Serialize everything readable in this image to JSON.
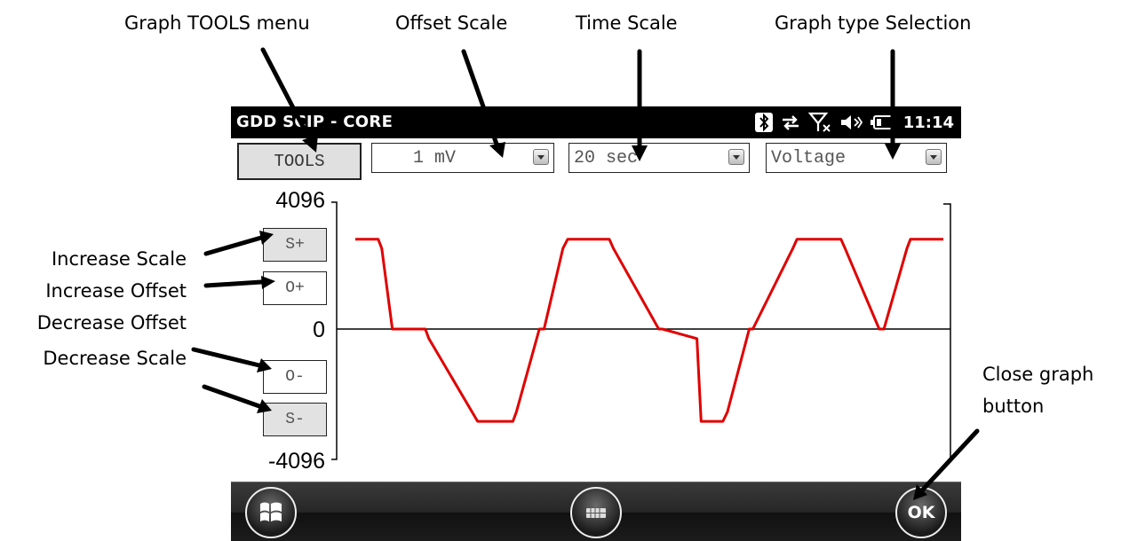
{
  "callouts": {
    "tools_menu": "Graph TOOLS menu",
    "offset_scale": "Offset Scale",
    "time_scale": "Time Scale",
    "graph_type": "Graph type Selection",
    "increase_scale": "Increase Scale",
    "increase_offset": "Increase Offset",
    "decrease_offset": "Decrease Offset",
    "decrease_scale": "Decrease Scale",
    "close_graph_line1": "Close graph",
    "close_graph_line2": "button"
  },
  "statusbar": {
    "app_title": "GDD SCIP - CORE",
    "time": "11:14",
    "icons": [
      "bluetooth-icon",
      "data-transfer-icon",
      "no-signal-icon",
      "speaker-icon",
      "battery-icon"
    ]
  },
  "toolbar": {
    "tools_label": "TOOLS",
    "offset_value": "1 mV",
    "time_value": "20 sec",
    "graph_type_value": "Voltage"
  },
  "scale_buttons": {
    "s_plus": "S+",
    "o_plus": "O+",
    "o_minus": "O-",
    "s_minus": "S-"
  },
  "softkeys": {
    "start_icon": "windows-start-icon",
    "keyboard_icon": "keyboard-icon",
    "ok_label": "OK"
  },
  "colors": {
    "signal": "#e00000",
    "statusbar": "#000000"
  },
  "chart_data": {
    "type": "line",
    "y_ticks": [
      "4096",
      "0",
      "-4096"
    ],
    "ylim": [
      -4096,
      4096
    ],
    "xlim": [
      0,
      100
    ],
    "series": [
      {
        "x": [
          0,
          3.9,
          4.5,
          6.3,
          7.1,
          11.9,
          12.5,
          20.8,
          21.5,
          26.8,
          27.4,
          31.3,
          32.1,
          35.3,
          36.1,
          43.2,
          43.9,
          51.6,
          52.2,
          58.1,
          58.8,
          62.5,
          63.3,
          67.0,
          67.6,
          74.4,
          75.1,
          82.6,
          83.3,
          89.1,
          89.9,
          93.8,
          94.4,
          100
        ],
        "y": [
          2900,
          2900,
          2600,
          0,
          0,
          0,
          -300,
          -2900,
          -2900,
          -2900,
          -2600,
          0,
          0,
          2600,
          2900,
          2900,
          2600,
          0,
          0,
          -300,
          -2900,
          -2900,
          -2600,
          0,
          0,
          2600,
          2900,
          2900,
          2600,
          0,
          0,
          2600,
          2900,
          2900
        ]
      }
    ]
  }
}
